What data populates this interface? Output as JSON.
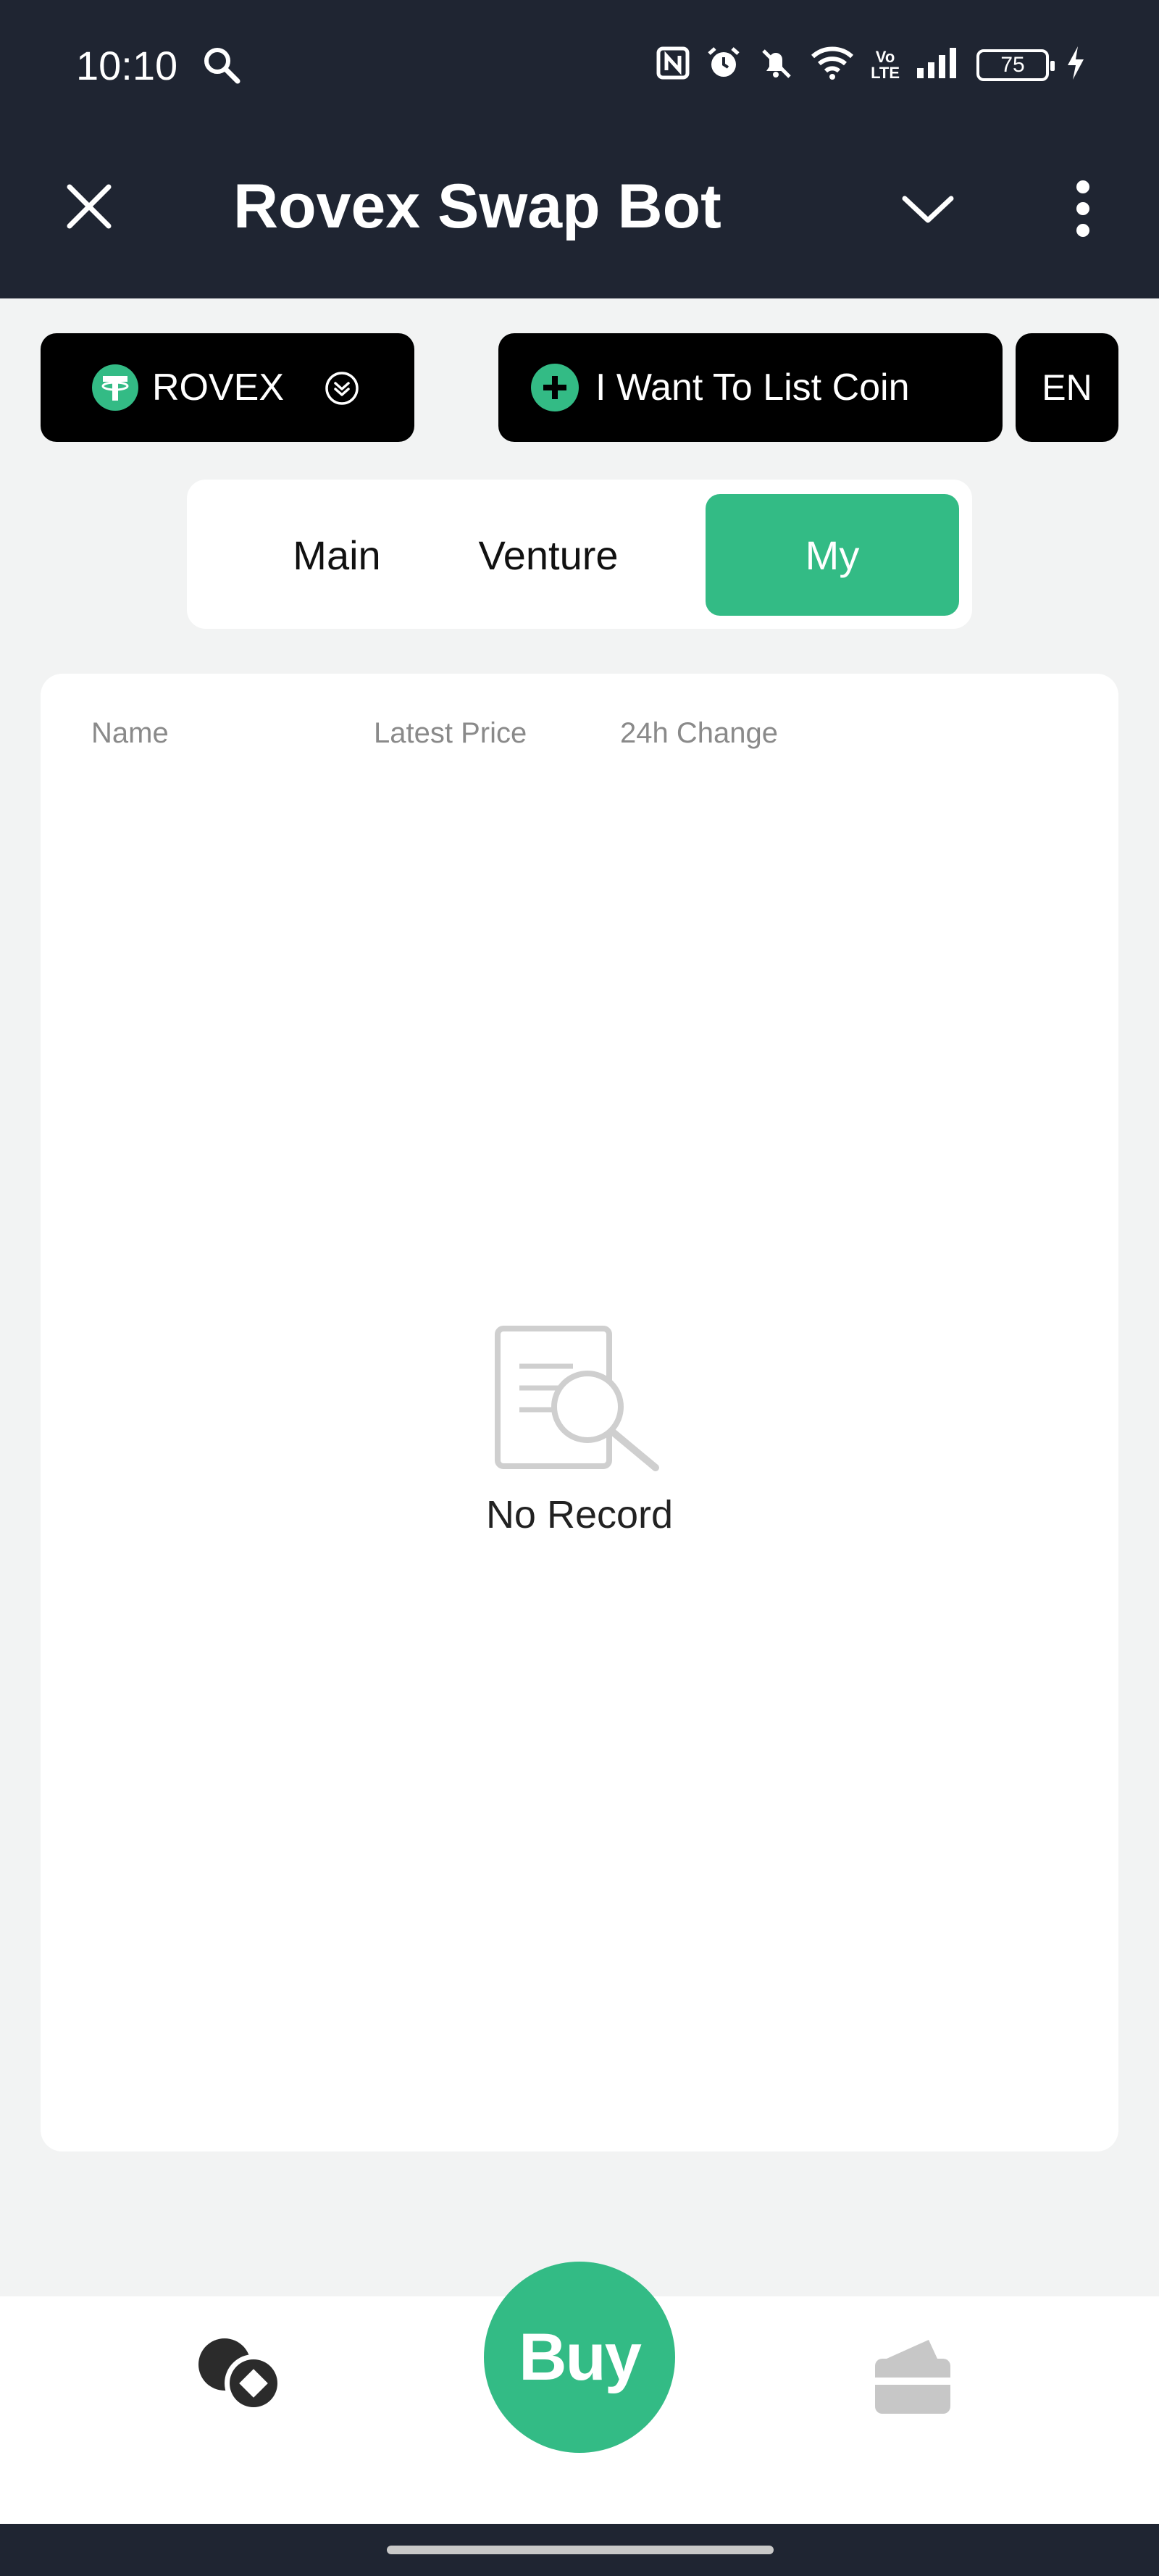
{
  "status_bar": {
    "time": "10:10",
    "battery": "75",
    "lte_top": "Vo",
    "lte_bottom": "LTE"
  },
  "header": {
    "title": "Rovex Swap Bot"
  },
  "controls": {
    "token_label": "ROVEX",
    "list_coin_label": "I Want To List Coin",
    "language_label": "EN"
  },
  "tabs": [
    {
      "label": "Main",
      "active": false
    },
    {
      "label": "Venture",
      "active": false
    },
    {
      "label": "My",
      "active": true
    }
  ],
  "table": {
    "columns": [
      "Name",
      "Latest Price",
      "24h Change"
    ],
    "empty_text": "No Record"
  },
  "bottom_nav": {
    "buy_label": "Buy"
  },
  "colors": {
    "accent": "#33bb85",
    "header_bg": "#1f2532",
    "pill_bg": "#000000"
  }
}
